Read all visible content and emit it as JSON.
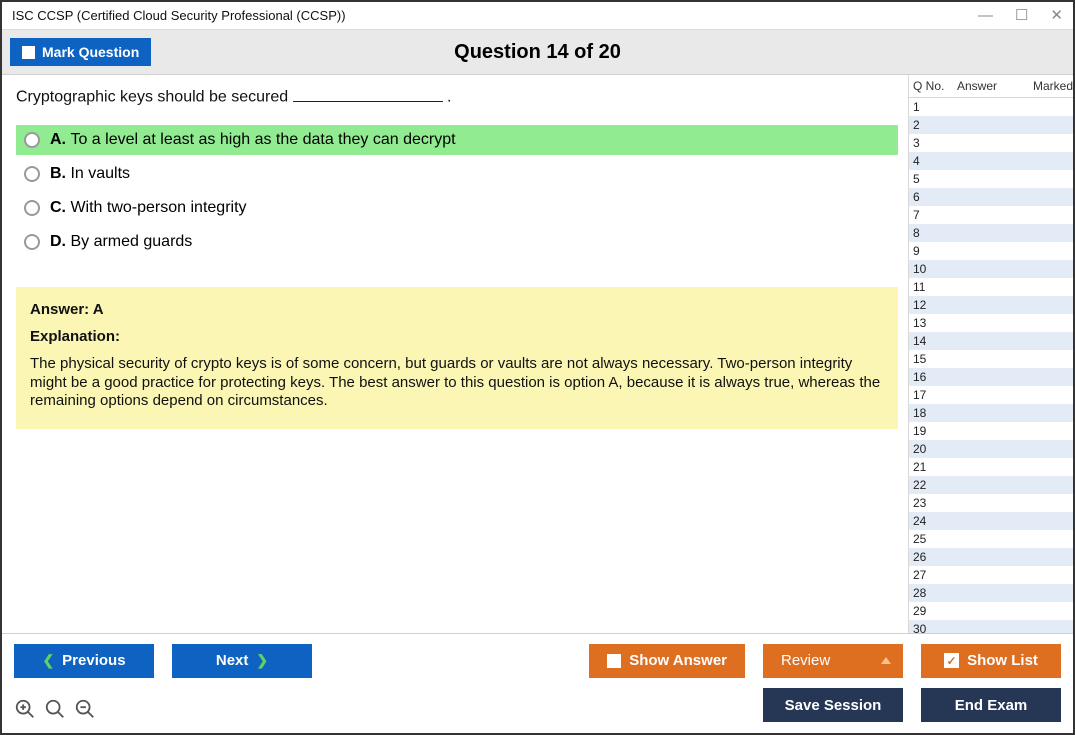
{
  "window": {
    "title": "ISC CCSP (Certified Cloud Security Professional (CCSP))"
  },
  "header": {
    "mark_label": "Mark Question",
    "question_header": "Question 14 of 20"
  },
  "question": {
    "text_before": "Cryptographic keys should be secured ",
    "text_after": " .",
    "options": [
      {
        "letter": "A.",
        "text": "To a level at least as high as the data they can decrypt",
        "correct": true
      },
      {
        "letter": "B.",
        "text": "In vaults",
        "correct": false
      },
      {
        "letter": "C.",
        "text": "With two-person integrity",
        "correct": false
      },
      {
        "letter": "D.",
        "text": "By armed guards",
        "correct": false
      }
    ]
  },
  "answer": {
    "line": "Answer: A",
    "explanation_head": "Explanation:",
    "explanation_text": "The physical security of crypto keys is of some concern, but guards or vaults are not always necessary. Two-person integrity might be a good practice for protecting keys. The best answer to this question is option A, because it is always true, whereas the remaining options depend on circumstances."
  },
  "sidebar": {
    "headers": {
      "qno": "Q No.",
      "answer": "Answer",
      "marked": "Marked"
    },
    "rows": [
      1,
      2,
      3,
      4,
      5,
      6,
      7,
      8,
      9,
      10,
      11,
      12,
      13,
      14,
      15,
      16,
      17,
      18,
      19,
      20,
      21,
      22,
      23,
      24,
      25,
      26,
      27,
      28,
      29,
      30
    ]
  },
  "footer": {
    "previous": "Previous",
    "next": "Next",
    "show_answer": "Show Answer",
    "review": "Review",
    "show_list": "Show List",
    "save_session": "Save Session",
    "end_exam": "End Exam"
  }
}
